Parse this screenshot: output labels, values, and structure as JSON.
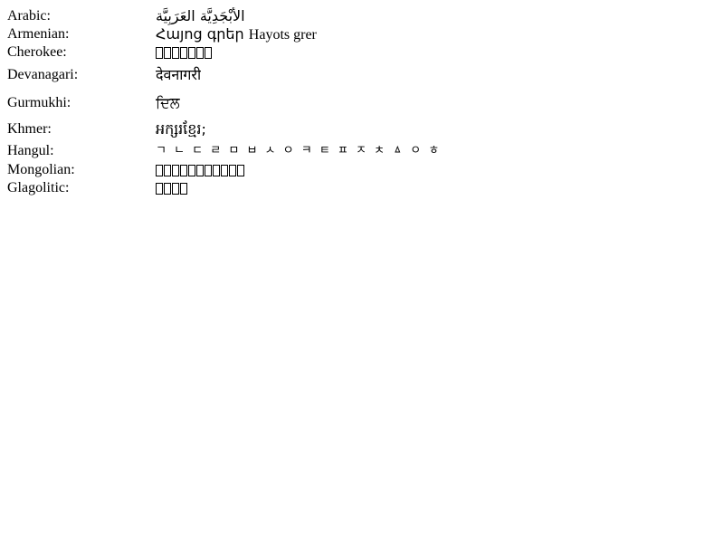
{
  "rows": [
    {
      "id": "arabic",
      "label": "Arabic:",
      "sample": "الأَبْجَدِيَّة العَرَبِيَّة"
    },
    {
      "id": "armenian",
      "label": "Armenian:",
      "sample": "Հայոց գրեր",
      "transliteration": "Hayots grer"
    },
    {
      "id": "cherokee",
      "label": "Cherokee:",
      "sample": "ᏣᎳᎩ ᎦᏬᏂᎯᏍᏗ",
      "visible_glyph_count": 7
    },
    {
      "id": "devanagari",
      "label": "Devanagari:",
      "sample": "देवनागरी"
    },
    {
      "id": "gurmukhi",
      "label": "Gurmukhi:",
      "sample": "ਦਿਲ"
    },
    {
      "id": "khmer",
      "label": "Khmer:",
      "sample": "អក្សរខ្មែរ;"
    },
    {
      "id": "hangul",
      "label": "Hangul:",
      "sample": "ㄱ ㄴ ㄷ ㄹ ㅁ ㅂ ㅅ ㅇ ㅋ ㅌ ㅍ ㅈ ㅊ ㅿ ㅇ ㅎ"
    },
    {
      "id": "mongolian",
      "label": "Mongolian:",
      "sample": "ᠮᠣᠩᠭᠣᠯ ᠪᠢᠴᠢᠭ",
      "visible_glyph_count": 11
    },
    {
      "id": "glagolitic",
      "label": "Glagolitic:",
      "sample": "ⰳⰾⰰⰳⱁ",
      "visible_glyph_count": 4
    }
  ]
}
